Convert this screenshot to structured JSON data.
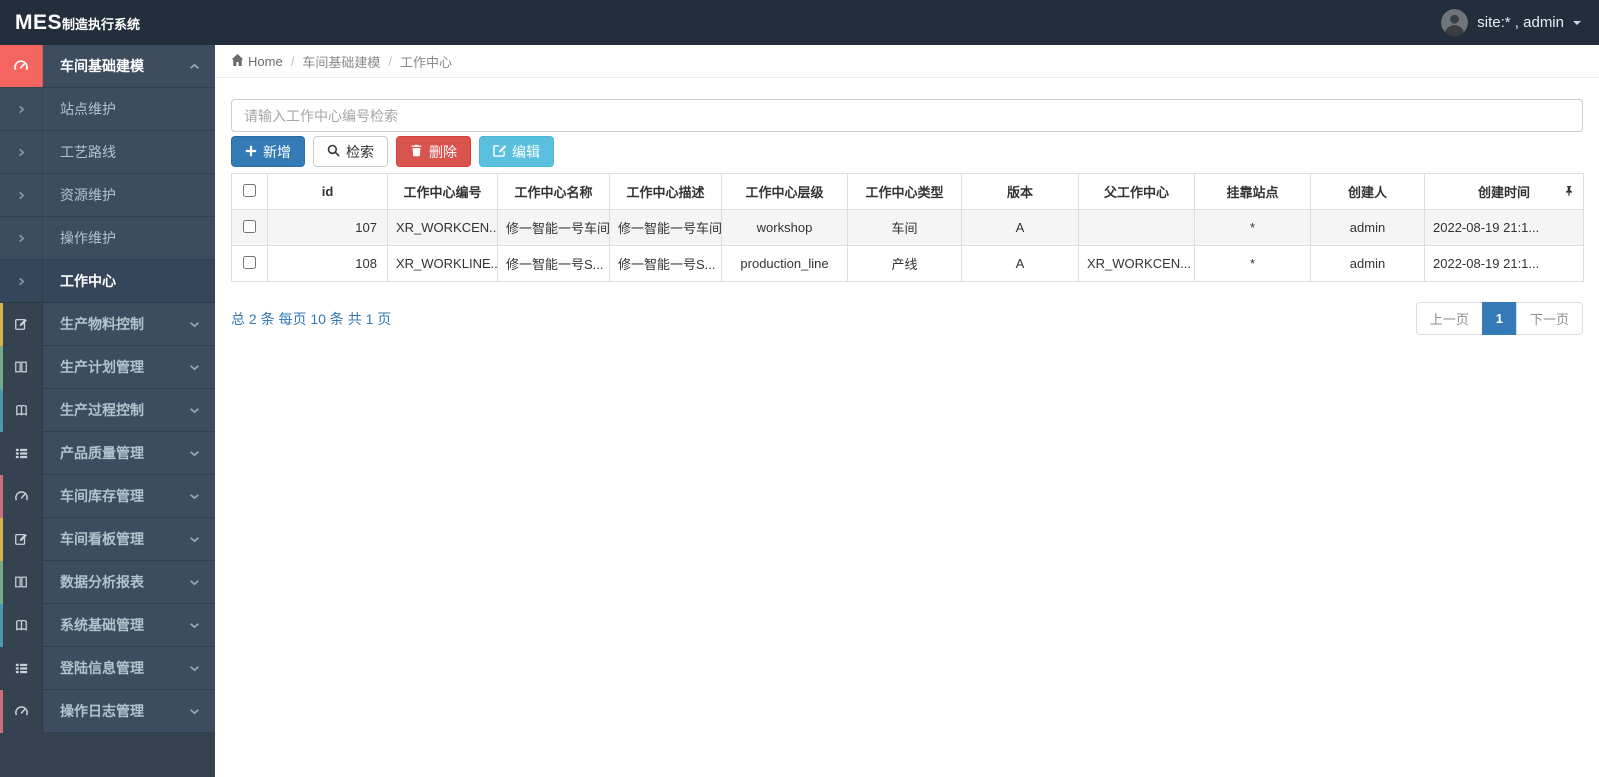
{
  "topbar": {
    "brand_primary": "MES",
    "brand_secondary": "制造执行系统",
    "user_label": "site:* , admin"
  },
  "sidebar": {
    "items": [
      {
        "label": "车间基础建模",
        "state": "open-active-group"
      },
      {
        "label": "站点维护"
      },
      {
        "label": "工艺路线"
      },
      {
        "label": "资源维护"
      },
      {
        "label": "操作维护"
      },
      {
        "label": "工作中心",
        "state": "active"
      },
      {
        "label": "生产物料控制"
      },
      {
        "label": "生产计划管理"
      },
      {
        "label": "生产过程控制"
      },
      {
        "label": "产品质量管理"
      },
      {
        "label": "车间库存管理"
      },
      {
        "label": "车间看板管理"
      },
      {
        "label": "数据分析报表"
      },
      {
        "label": "系统基础管理"
      },
      {
        "label": "登陆信息管理"
      },
      {
        "label": "操作日志管理"
      }
    ]
  },
  "breadcrumb": {
    "home": "Home",
    "level1": "车间基础建模",
    "level2": "工作中心",
    "separator": "/"
  },
  "toolbar": {
    "search_placeholder": "请输入工作中心编号检索",
    "add_label": "新增",
    "search_label": "检索",
    "delete_label": "删除",
    "edit_label": "编辑"
  },
  "table": {
    "columns": [
      "id",
      "工作中心编号",
      "工作中心名称",
      "工作中心描述",
      "工作中心层级",
      "工作中心类型",
      "版本",
      "父工作中心",
      "挂靠站点",
      "创建人",
      "创建时间"
    ],
    "rows": [
      {
        "cells": [
          "107",
          "XR_WORKCEN...",
          "修一智能一号车间",
          "修一智能一号车间",
          "workshop",
          "车间",
          "A",
          "",
          "*",
          "admin",
          "2022-08-19 21:1..."
        ]
      },
      {
        "cells": [
          "108",
          "XR_WORKLINE...",
          "修一智能一号S...",
          "修一智能一号S...",
          "production_line",
          "产线",
          "A",
          "XR_WORKCEN...",
          "*",
          "admin",
          "2022-08-19 21:1..."
        ]
      }
    ]
  },
  "pagination": {
    "summary": "总 2 条 每页 10 条 共 1 页",
    "prev_label": "上一页",
    "current_page": "1",
    "next_label": "下一页"
  },
  "icons": {
    "gauge-icon": "speedometer glyph",
    "edit-square-icon": "pencil in square",
    "columns-icon": "two columns",
    "book-icon": "open book",
    "list-icon": "th-list rows",
    "chevron-right-icon": "›",
    "chevron-up-icon": "˄",
    "chevron-down-icon": "˅",
    "home-icon": "house",
    "plus-icon": "+",
    "search-icon": "magnifier",
    "trash-icon": "trash can",
    "pin-icon": "thumbtack",
    "caret-down-icon": "▾"
  },
  "colors": {
    "topbar_bg": "#232e3c",
    "sidebar_bg": "#3c4d60",
    "sidebar_icon_col_bg": "#35424f",
    "active_group_accent": "#f4655f",
    "primary": "#337ab7",
    "danger": "#d9534f",
    "info": "#5bc0de",
    "strip_yellow": "#d6b24a",
    "strip_green": "#73ab85",
    "strip_teal": "#4f96ac",
    "strip_red": "#cb6f78"
  }
}
